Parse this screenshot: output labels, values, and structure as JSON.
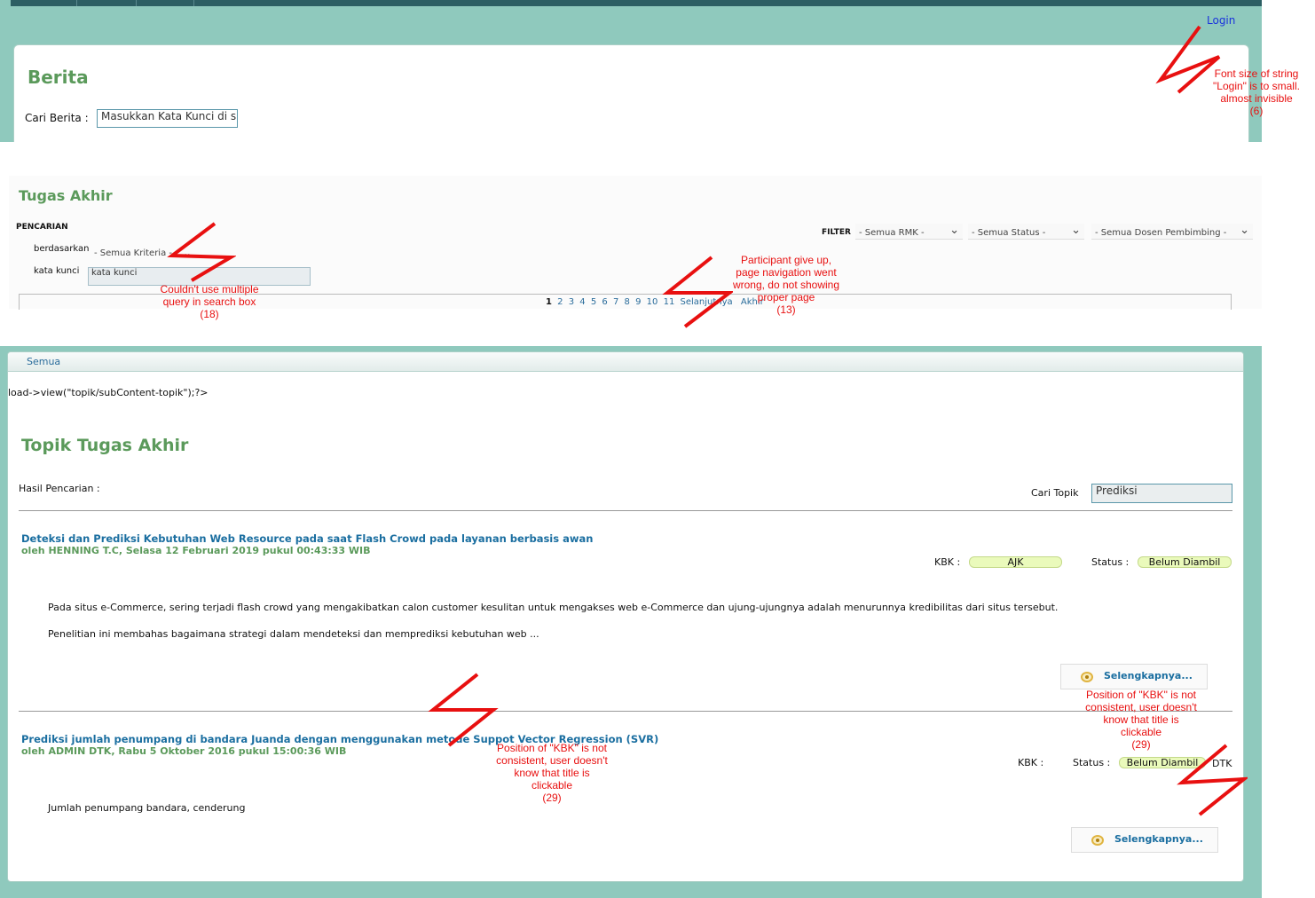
{
  "berita": {
    "login_link": "Login",
    "title": "Berita",
    "search_label": "Cari Berita :",
    "search_value": "Masukkan Kata Kunci di sin"
  },
  "tugas_akhir": {
    "title": "Tugas Akhir",
    "pencarian_label": "PENCARIAN",
    "berdasarkan_label": "berdasarkan",
    "kata_kunci_label": "kata kunci",
    "kriteria_selected": "- Semua Kriteria -",
    "kata_kunci_value": "kata kunci",
    "filter_label": "FILTER",
    "filters": [
      "- Semua RMK -",
      "- Semua Status -",
      "- Semua Dosen Pembimbing -"
    ],
    "pager": {
      "current": "1",
      "pages": [
        "2",
        "3",
        "4",
        "5",
        "6",
        "7",
        "8",
        "9",
        "10",
        "11"
      ],
      "next_label": "Selanjutnya",
      "last_label": "Akhir"
    }
  },
  "topik": {
    "tab_label": "Semua",
    "php_leak_text": "load->view(\"topik/subContent-topik\");?>",
    "title": "Topik Tugas Akhir",
    "hasil_label": "Hasil Pencarian :",
    "cari_topik_label": "Cari Topik",
    "cari_topik_value": "Prediksi",
    "kbk_label": "KBK :",
    "status_label": "Status :",
    "more_label": "Selengkapnya...",
    "items": [
      {
        "title": "Deteksi dan Prediksi Kebutuhan Web Resource pada saat Flash Crowd pada layanan berbasis awan",
        "meta": "oleh HENNING T.C, Selasa 12 Februari 2019 pukul 00:43:33 WIB",
        "kbk": "AJK",
        "status": "Belum Diambil",
        "paragraphs": [
          "Pada situs e-Commerce, sering terjadi flash crowd yang mengakibatkan calon customer kesulitan untuk mengakses web e-Commerce dan ujung-ujungnya adalah menurunnya kredibilitas dari situs tersebut.",
          "Penelitian ini membahas bagaimana strategi dalam mendeteksi dan memprediksi kebutuhan web ..."
        ]
      },
      {
        "title": "Prediksi jumlah penumpang di bandara Juanda dengan menggunakan metode Suppot Vector Regression (SVR)",
        "meta": "oleh ADMIN DTK, Rabu 5 Oktober 2016 pukul 15:00:36 WIB",
        "kbk": "DTK",
        "status": "Belum Diambil",
        "paragraphs": [
          "Jumlah penumpang bandara, cenderung"
        ]
      }
    ]
  },
  "annotations": {
    "login_font": "Font size of string\n\"Login\" is to small.\nalmost invisible\n(6)",
    "multiple_query": "Couldn't use multiple\nquery in search box\n(18)",
    "page_nav": "Participant give up,\npage navigation went\nwrong, do not showing\nproper page\n(13)",
    "kbk_position_1": "Position of \"KBK\" is not\nconsistent, user doesn't\nknow that title is\nclickable\n(29)",
    "kbk_position_2": "Position of \"KBK\" is not\nconsistent, user doesn't\nknow that title is\nclickable\n(29)",
    "mark_color": "#e81010"
  }
}
